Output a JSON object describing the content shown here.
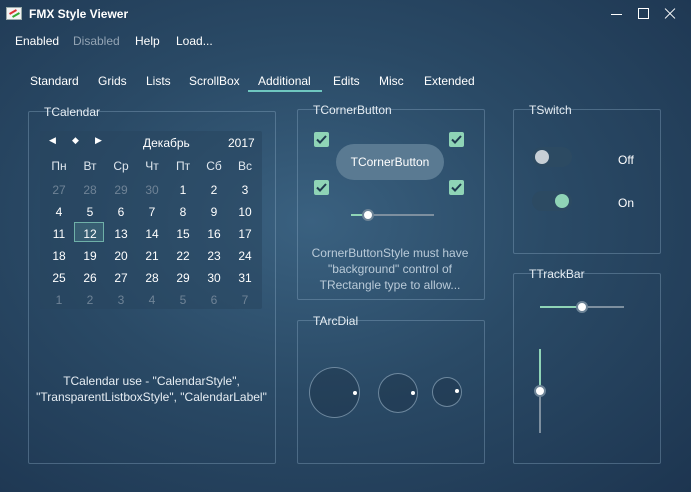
{
  "window": {
    "title": "FMX Style Viewer"
  },
  "menu": {
    "enabled": "Enabled",
    "disabled": "Disabled",
    "help": "Help",
    "load": "Load..."
  },
  "tabs": [
    "Standard",
    "Grids",
    "Lists",
    "ScrollBox",
    "Additional",
    "Edits",
    "Misc",
    "Extended"
  ],
  "active_tab": "Additional",
  "calendar": {
    "group_title": "TCalendar",
    "month": "Декабрь",
    "year": "2017",
    "weekdays": [
      "Пн",
      "Вт",
      "Ср",
      "Чт",
      "Пт",
      "Сб",
      "Вс"
    ],
    "weeks": [
      [
        "27",
        "28",
        "29",
        "30",
        "1",
        "2",
        "3"
      ],
      [
        "4",
        "5",
        "6",
        "7",
        "8",
        "9",
        "10"
      ],
      [
        "11",
        "12",
        "13",
        "14",
        "15",
        "16",
        "17"
      ],
      [
        "18",
        "19",
        "20",
        "21",
        "22",
        "23",
        "24"
      ],
      [
        "25",
        "26",
        "27",
        "28",
        "29",
        "30",
        "31"
      ],
      [
        "1",
        "2",
        "3",
        "4",
        "5",
        "6",
        "7"
      ]
    ],
    "selected_day": "12",
    "caption_line1": "TCalendar use - \"CalendarStyle\",",
    "caption_line2": "\"TransparentListboxStyle\", \"CalendarLabel\""
  },
  "corner_button": {
    "group_title": "TCornerButton",
    "button_label": "TCornerButton",
    "checkboxes_checked": [
      true,
      true,
      true,
      true
    ],
    "slider_value": 0.2,
    "caption_line1": "CornerButtonStyle must have",
    "caption_line2": "\"background\" control of",
    "caption_line3": "TRectangle type to allow..."
  },
  "arc_dial": {
    "group_title": "TArcDial"
  },
  "switch": {
    "group_title": "TSwitch",
    "items": [
      {
        "label": "Off",
        "on": false
      },
      {
        "label": "On",
        "on": true
      }
    ]
  },
  "trackbar": {
    "group_title": "TTrackBar",
    "horizontal_value": 0.5,
    "vertical_value": 0.5
  },
  "colors": {
    "accent": "#8fd4b6",
    "tab_underline": "#6fc7c0"
  }
}
